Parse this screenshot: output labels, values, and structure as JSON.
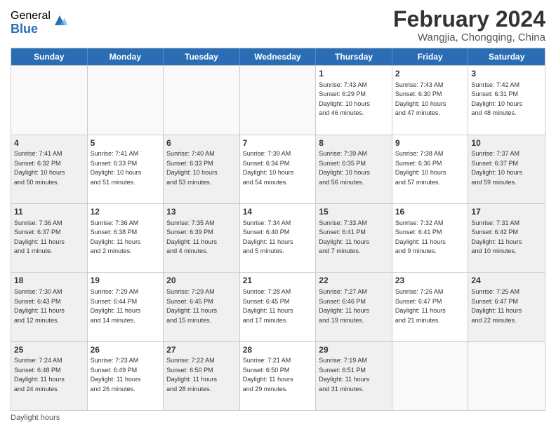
{
  "logo": {
    "general": "General",
    "blue": "Blue"
  },
  "title": "February 2024",
  "subtitle": "Wangjia, Chongqing, China",
  "days_of_week": [
    "Sunday",
    "Monday",
    "Tuesday",
    "Wednesday",
    "Thursday",
    "Friday",
    "Saturday"
  ],
  "footer": "Daylight hours",
  "weeks": [
    [
      {
        "day": "",
        "info": "",
        "empty": true
      },
      {
        "day": "",
        "info": "",
        "empty": true
      },
      {
        "day": "",
        "info": "",
        "empty": true
      },
      {
        "day": "",
        "info": "",
        "empty": true
      },
      {
        "day": "1",
        "info": "Sunrise: 7:43 AM\nSunset: 6:29 PM\nDaylight: 10 hours\nand 46 minutes."
      },
      {
        "day": "2",
        "info": "Sunrise: 7:43 AM\nSunset: 6:30 PM\nDaylight: 10 hours\nand 47 minutes."
      },
      {
        "day": "3",
        "info": "Sunrise: 7:42 AM\nSunset: 6:31 PM\nDaylight: 10 hours\nand 48 minutes."
      }
    ],
    [
      {
        "day": "4",
        "info": "Sunrise: 7:41 AM\nSunset: 6:32 PM\nDaylight: 10 hours\nand 50 minutes.",
        "shaded": true
      },
      {
        "day": "5",
        "info": "Sunrise: 7:41 AM\nSunset: 6:33 PM\nDaylight: 10 hours\nand 51 minutes."
      },
      {
        "day": "6",
        "info": "Sunrise: 7:40 AM\nSunset: 6:33 PM\nDaylight: 10 hours\nand 53 minutes.",
        "shaded": true
      },
      {
        "day": "7",
        "info": "Sunrise: 7:39 AM\nSunset: 6:34 PM\nDaylight: 10 hours\nand 54 minutes."
      },
      {
        "day": "8",
        "info": "Sunrise: 7:39 AM\nSunset: 6:35 PM\nDaylight: 10 hours\nand 56 minutes.",
        "shaded": true
      },
      {
        "day": "9",
        "info": "Sunrise: 7:38 AM\nSunset: 6:36 PM\nDaylight: 10 hours\nand 57 minutes."
      },
      {
        "day": "10",
        "info": "Sunrise: 7:37 AM\nSunset: 6:37 PM\nDaylight: 10 hours\nand 59 minutes.",
        "shaded": true
      }
    ],
    [
      {
        "day": "11",
        "info": "Sunrise: 7:36 AM\nSunset: 6:37 PM\nDaylight: 11 hours\nand 1 minute.",
        "shaded": true
      },
      {
        "day": "12",
        "info": "Sunrise: 7:36 AM\nSunset: 6:38 PM\nDaylight: 11 hours\nand 2 minutes."
      },
      {
        "day": "13",
        "info": "Sunrise: 7:35 AM\nSunset: 6:39 PM\nDaylight: 11 hours\nand 4 minutes.",
        "shaded": true
      },
      {
        "day": "14",
        "info": "Sunrise: 7:34 AM\nSunset: 6:40 PM\nDaylight: 11 hours\nand 5 minutes."
      },
      {
        "day": "15",
        "info": "Sunrise: 7:33 AM\nSunset: 6:41 PM\nDaylight: 11 hours\nand 7 minutes.",
        "shaded": true
      },
      {
        "day": "16",
        "info": "Sunrise: 7:32 AM\nSunset: 6:41 PM\nDaylight: 11 hours\nand 9 minutes."
      },
      {
        "day": "17",
        "info": "Sunrise: 7:31 AM\nSunset: 6:42 PM\nDaylight: 11 hours\nand 10 minutes.",
        "shaded": true
      }
    ],
    [
      {
        "day": "18",
        "info": "Sunrise: 7:30 AM\nSunset: 6:43 PM\nDaylight: 11 hours\nand 12 minutes.",
        "shaded": true
      },
      {
        "day": "19",
        "info": "Sunrise: 7:29 AM\nSunset: 6:44 PM\nDaylight: 11 hours\nand 14 minutes."
      },
      {
        "day": "20",
        "info": "Sunrise: 7:29 AM\nSunset: 6:45 PM\nDaylight: 11 hours\nand 15 minutes.",
        "shaded": true
      },
      {
        "day": "21",
        "info": "Sunrise: 7:28 AM\nSunset: 6:45 PM\nDaylight: 11 hours\nand 17 minutes."
      },
      {
        "day": "22",
        "info": "Sunrise: 7:27 AM\nSunset: 6:46 PM\nDaylight: 11 hours\nand 19 minutes.",
        "shaded": true
      },
      {
        "day": "23",
        "info": "Sunrise: 7:26 AM\nSunset: 6:47 PM\nDaylight: 11 hours\nand 21 minutes."
      },
      {
        "day": "24",
        "info": "Sunrise: 7:25 AM\nSunset: 6:47 PM\nDaylight: 11 hours\nand 22 minutes.",
        "shaded": true
      }
    ],
    [
      {
        "day": "25",
        "info": "Sunrise: 7:24 AM\nSunset: 6:48 PM\nDaylight: 11 hours\nand 24 minutes.",
        "shaded": true
      },
      {
        "day": "26",
        "info": "Sunrise: 7:23 AM\nSunset: 6:49 PM\nDaylight: 11 hours\nand 26 minutes."
      },
      {
        "day": "27",
        "info": "Sunrise: 7:22 AM\nSunset: 6:50 PM\nDaylight: 11 hours\nand 28 minutes.",
        "shaded": true
      },
      {
        "day": "28",
        "info": "Sunrise: 7:21 AM\nSunset: 6:50 PM\nDaylight: 11 hours\nand 29 minutes."
      },
      {
        "day": "29",
        "info": "Sunrise: 7:19 AM\nSunset: 6:51 PM\nDaylight: 11 hours\nand 31 minutes.",
        "shaded": true
      },
      {
        "day": "",
        "info": "",
        "empty": true
      },
      {
        "day": "",
        "info": "",
        "empty": true
      }
    ]
  ]
}
